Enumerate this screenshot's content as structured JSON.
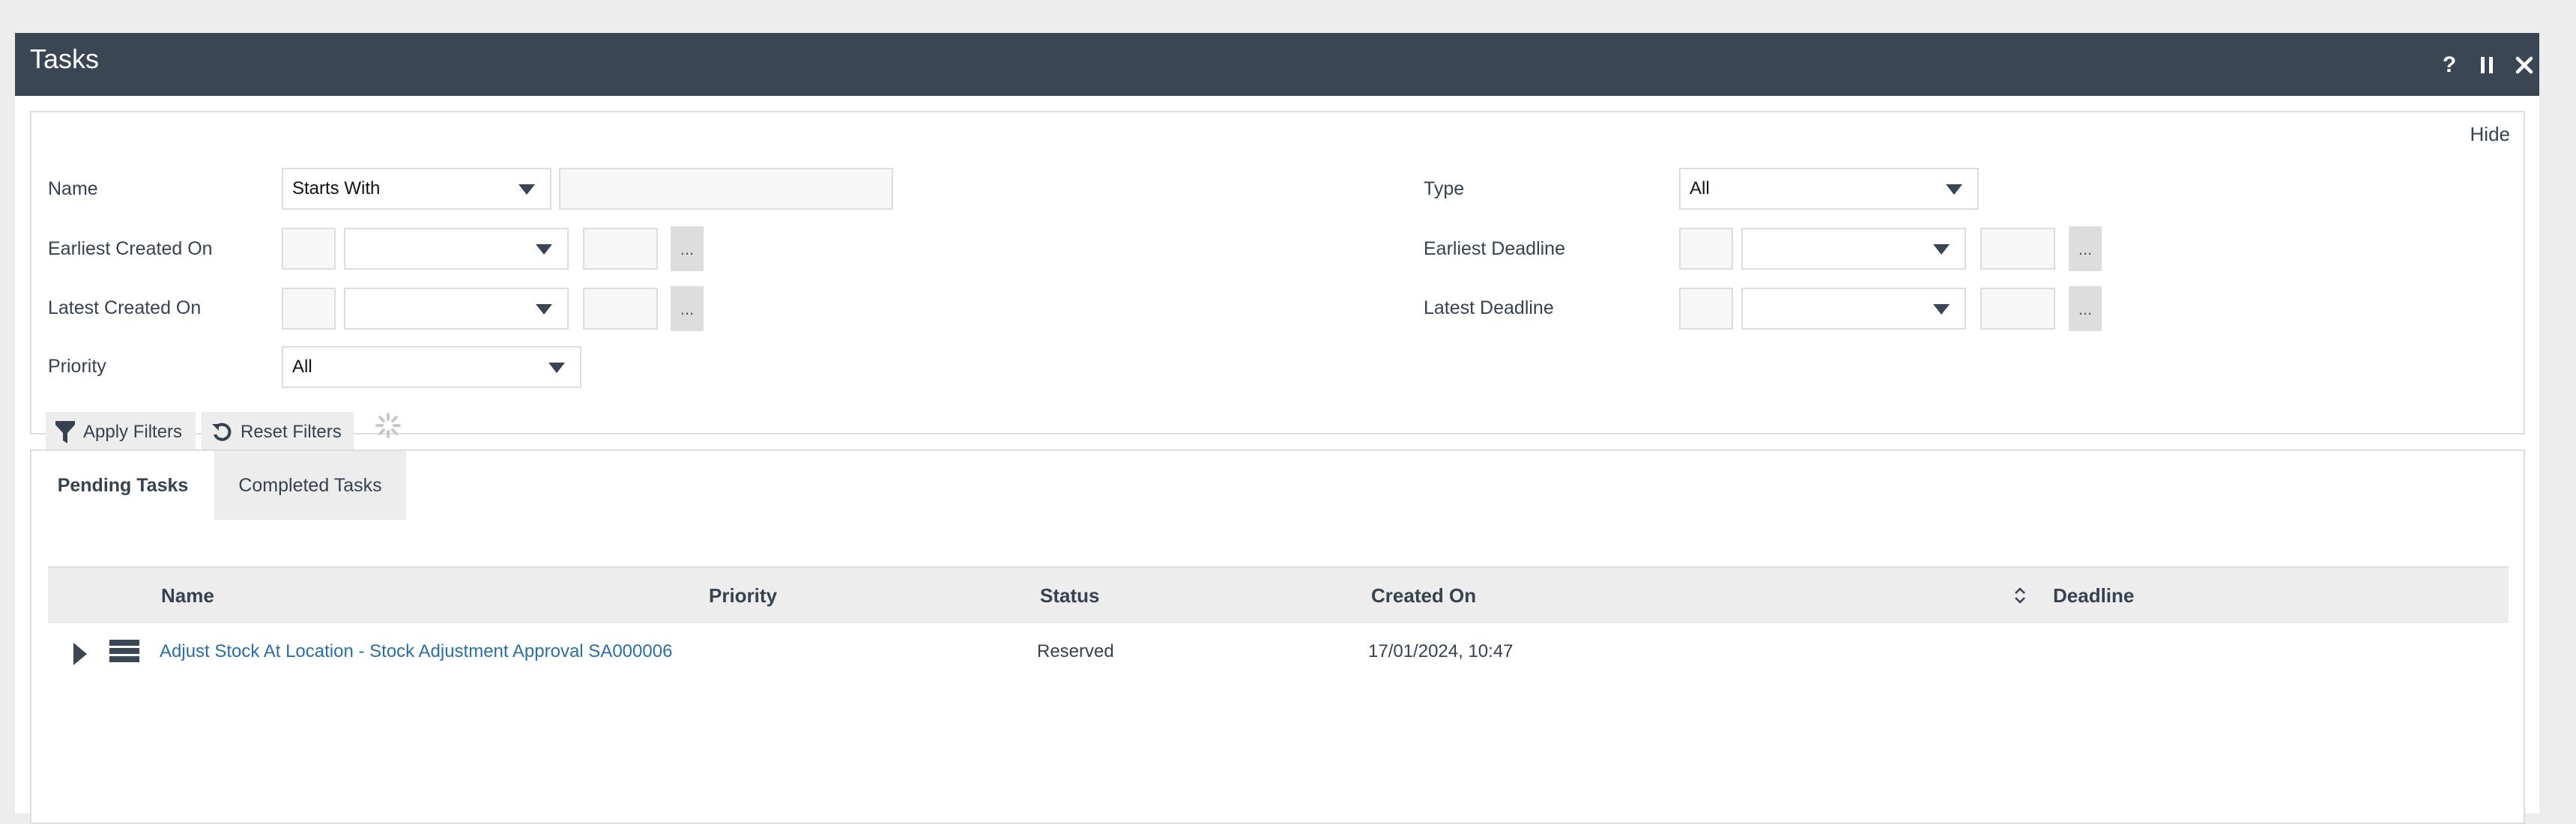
{
  "window": {
    "title": "Tasks",
    "controls": {
      "help": "?",
      "close": "✕"
    }
  },
  "filters": {
    "hide_label": "Hide",
    "name": {
      "label": "Name",
      "operator": "Starts With",
      "value": ""
    },
    "earliest_created_on": {
      "label": "Earliest Created On",
      "day": "",
      "month": "",
      "year": "",
      "picker": "..."
    },
    "latest_created_on": {
      "label": "Latest Created On",
      "day": "",
      "month": "",
      "year": "",
      "picker": "..."
    },
    "priority": {
      "label": "Priority",
      "value": "All"
    },
    "type": {
      "label": "Type",
      "value": "All"
    },
    "earliest_deadline": {
      "label": "Earliest Deadline",
      "day": "",
      "month": "",
      "year": "",
      "picker": "..."
    },
    "latest_deadline": {
      "label": "Latest Deadline",
      "day": "",
      "month": "",
      "year": "",
      "picker": "..."
    },
    "apply_label": "Apply Filters",
    "reset_label": "Reset Filters"
  },
  "tabs": [
    {
      "label": "Pending Tasks",
      "active": true
    },
    {
      "label": "Completed Tasks",
      "active": false
    }
  ],
  "table": {
    "columns": [
      "Name",
      "Priority",
      "Status",
      "Created On",
      "Deadline"
    ],
    "sorted_column": "Created On",
    "rows": [
      {
        "name": "Adjust Stock At Location - Stock Adjustment Approval SA000006",
        "priority": "",
        "status": "Reserved",
        "created_on": "17/01/2024, 10:47",
        "deadline": ""
      }
    ]
  },
  "colors": {
    "titlebar": "#3b4654",
    "link": "#2a6ea6",
    "header_bg": "#ededed",
    "text": "#36424f"
  }
}
